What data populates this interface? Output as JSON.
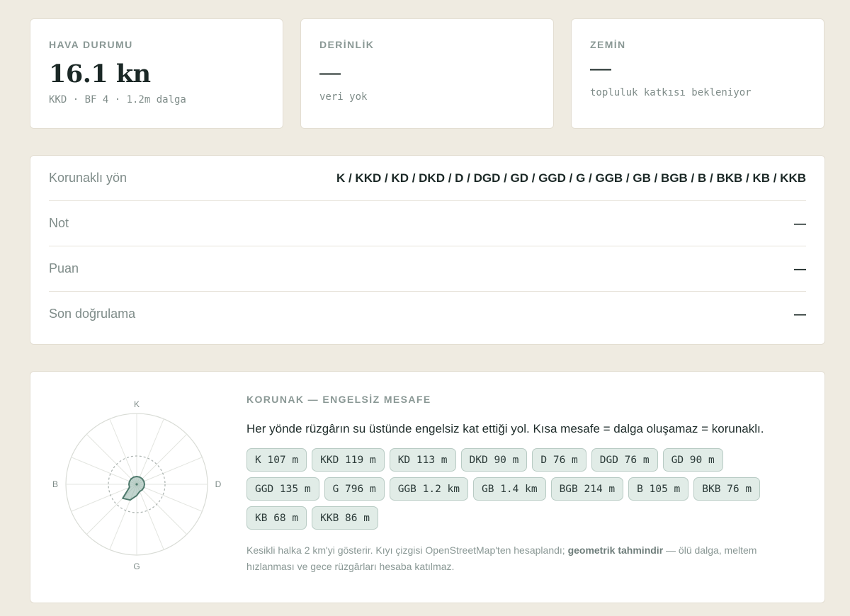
{
  "weather": {
    "label": "HAVA DURUMU",
    "value": "16.1 kn",
    "sub": "KKD · BF 4 · 1.2m dalga"
  },
  "depth": {
    "label": "DERİNLİK",
    "value": "—",
    "sub": "veri yok"
  },
  "ground": {
    "label": "ZEMİN",
    "value": "—",
    "sub": "topluluk katkısı bekleniyor"
  },
  "details": {
    "rows": [
      {
        "label": "Korunaklı yön",
        "value": "K / KKD / KD / DKD / D / DGD / GD / GGD / G / GGB / GB / BGB / B / BKB / KB / KKB"
      },
      {
        "label": "Not",
        "value": "—"
      },
      {
        "label": "Puan",
        "value": "—"
      },
      {
        "label": "Son doğrulama",
        "value": "—"
      }
    ]
  },
  "shelter": {
    "title": "KORUNAK — ENGELSİZ MESAFE",
    "description": "Her yönde rüzgârın su üstünde engelsiz kat ettiği yol. Kısa mesafe = dalga oluşamaz = korunaklı.",
    "compass": {
      "n": "K",
      "e": "D",
      "s": "G",
      "w": "B"
    },
    "distances": [
      {
        "dir": "K",
        "label": "K 107 m",
        "km": 0.107
      },
      {
        "dir": "KKD",
        "label": "KKD 119 m",
        "km": 0.119
      },
      {
        "dir": "KD",
        "label": "KD 113 m",
        "km": 0.113
      },
      {
        "dir": "DKD",
        "label": "DKD 90 m",
        "km": 0.09
      },
      {
        "dir": "D",
        "label": "D 76 m",
        "km": 0.076
      },
      {
        "dir": "DGD",
        "label": "DGD 76 m",
        "km": 0.076
      },
      {
        "dir": "GD",
        "label": "GD 90 m",
        "km": 0.09
      },
      {
        "dir": "GGD",
        "label": "GGD 135 m",
        "km": 0.135
      },
      {
        "dir": "G",
        "label": "G 796 m",
        "km": 0.796
      },
      {
        "dir": "GGB",
        "label": "GGB 1.2 km",
        "km": 1.2
      },
      {
        "dir": "GB",
        "label": "GB 1.4 km",
        "km": 1.4
      },
      {
        "dir": "BGB",
        "label": "BGB 214 m",
        "km": 0.214
      },
      {
        "dir": "B",
        "label": "B 105 m",
        "km": 0.105
      },
      {
        "dir": "BKB",
        "label": "BKB 76 m",
        "km": 0.076
      },
      {
        "dir": "KB",
        "label": "KB 68 m",
        "km": 0.068
      },
      {
        "dir": "KKB",
        "label": "KKB 86 m",
        "km": 0.086
      }
    ],
    "footnote_pre": "Kesikli halka 2 km'yi gösterir. Kıyı çizgisi OpenStreetMap'ten hesaplandı; ",
    "footnote_bold": "geometrik tahmindir",
    "footnote_post": " — ölü dalga, meltem hızlanması ve gece rüzgârları hesaba katılmaz.",
    "colors": {
      "fill": "#8fb3a7",
      "stroke": "#4f7a6d"
    }
  }
}
